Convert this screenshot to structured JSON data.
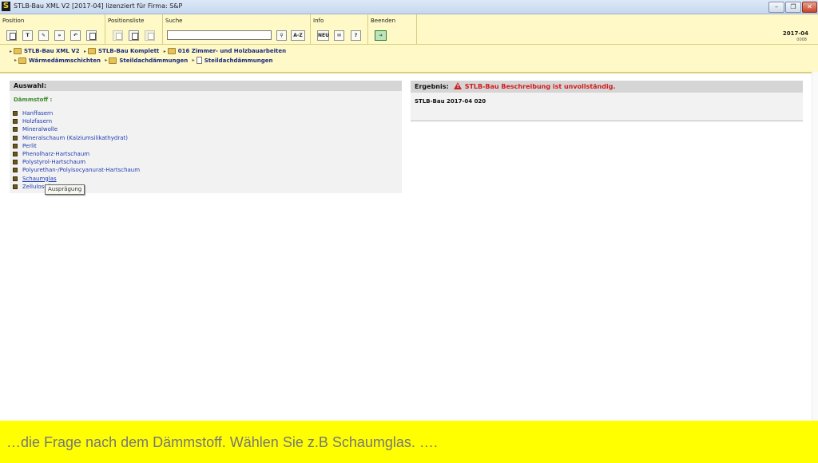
{
  "window": {
    "app_icon": "S",
    "title": "STLB-Bau XML V2 [2017-04] lizenziert für Firma: S&P"
  },
  "toolbar": {
    "groups": {
      "position": "Position",
      "positionsliste": "Positionsliste",
      "suche": "Suche",
      "info": "Info",
      "beenden": "Beenden"
    },
    "search_value": "",
    "az_label": "A-Z",
    "neu_label": "NEU",
    "help_label": "?",
    "version": "2017-04",
    "version_sub": "0008"
  },
  "breadcrumb": {
    "row1": [
      "STLB-Bau XML V2",
      "STLB-Bau Komplett",
      "016 Zimmer- und Holzbauarbeiten"
    ],
    "row2": [
      "Wärmedämmschichten",
      "Steildachdämmungen",
      "Steildachdämmungen"
    ]
  },
  "auswahl": {
    "header": "Auswahl:",
    "section": "Dämmstoff :",
    "options": [
      "Hanffasern",
      "Holzfasern",
      "Mineralwolle",
      "Mineralschaum (Kalziumsilikathydrat)",
      "Perlit",
      "Phenolharz-Hartschaum",
      "Polystyrol-Hartschaum",
      "Polyurethan-/Polyisocyanurat-Hartschaum",
      "Schaumglas",
      "Zellulosefasern"
    ],
    "tooltip": "Ausprägung"
  },
  "ergebnis": {
    "header": "Ergebnis:",
    "warning": "STLB-Bau Beschreibung ist unvollständig.",
    "value": "STLB-Bau 2017-04 020"
  },
  "caption": "…die Frage nach dem Dämmstoff. Wählen Sie z.B Schaumglas. …."
}
